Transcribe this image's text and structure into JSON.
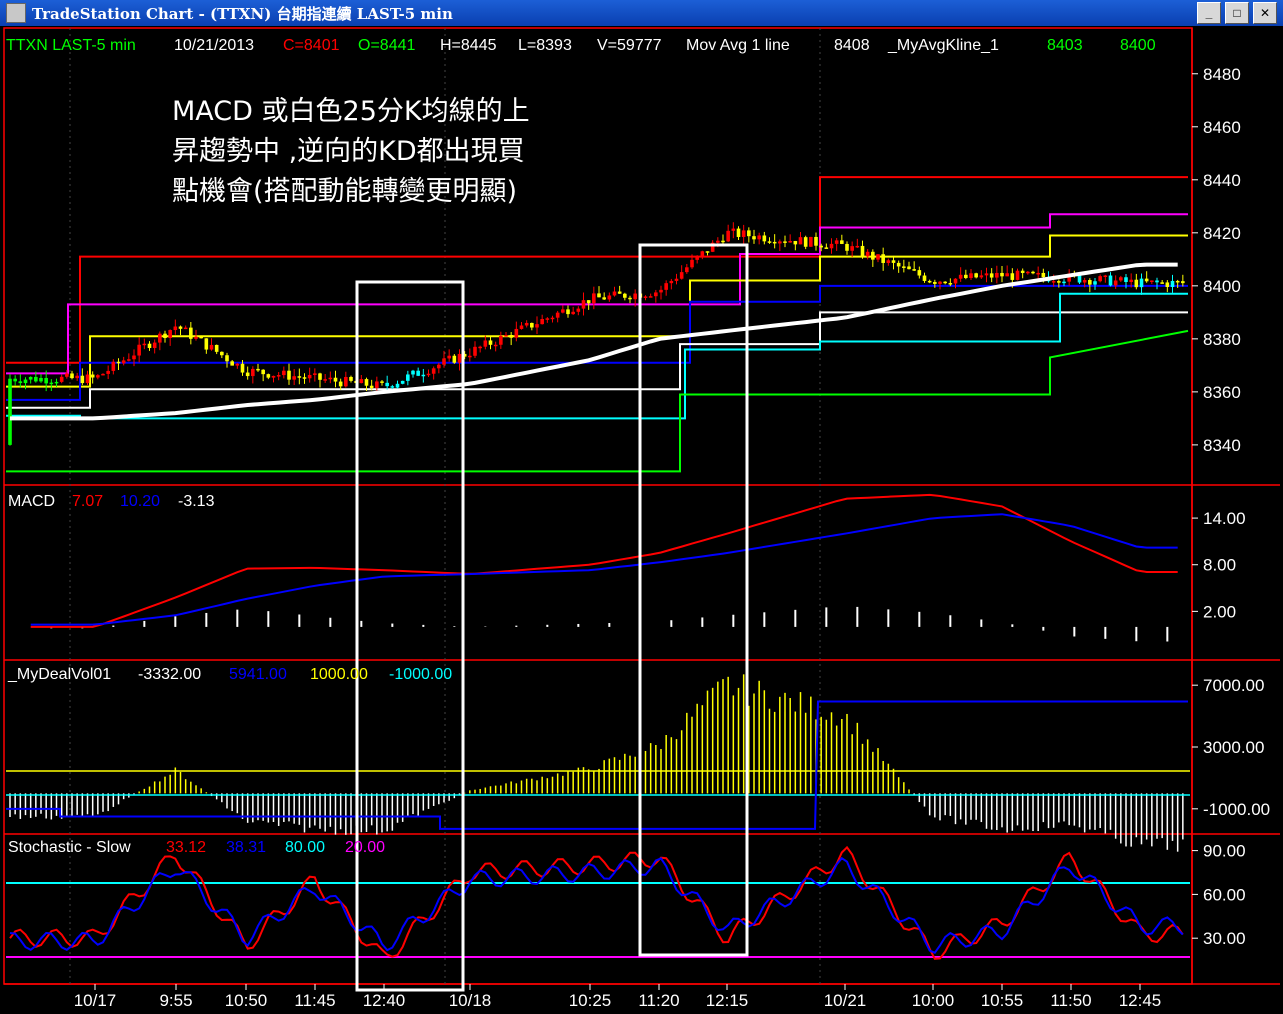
{
  "window": {
    "title": "TradeStation Chart - (TTXN) 台期指連續 LAST-5 min",
    "buttons": [
      "minimize",
      "maximize",
      "close"
    ]
  },
  "colors": {
    "background": "#000000",
    "up_candle": "#ff0000",
    "down_candle": "#ffff00",
    "cyan": "#00ffff",
    "green": "#00ff00",
    "blue": "#0000ff",
    "magenta": "#ff00ff",
    "white": "#ffffff"
  },
  "header": {
    "symbol": "TTXN LAST-5 min",
    "date": "10/21/2013",
    "close": "C=8401",
    "open": "O=8441",
    "high": "H=8445",
    "low": "L=8393",
    "volume": "V=59777",
    "study1": "Mov Avg 1 line",
    "study1_value": "8408",
    "study2": "_MyAvgKline_1",
    "study2_v1": "8403",
    "study2_v2": "8400"
  },
  "annotation": {
    "line1": "MACD 或白色25分K均線的上",
    "line2": "昇趨勢中 ,逆向的KD都出現買",
    "line3": "點機會(搭配動能轉變更明顯)"
  },
  "panels": {
    "macd": {
      "name": "MACD",
      "v1": "7.07",
      "v2": "10.20",
      "v3": "-3.13"
    },
    "dealvol": {
      "name": "_MyDealVol01",
      "v1": "-3332.00",
      "v2": "5941.00",
      "v3": "1000.00",
      "v4": "-1000.00"
    },
    "stoch": {
      "name": "Stochastic - Slow",
      "v1": "33.12",
      "v2": "38.31",
      "v3": "80.00",
      "v4": "20.00"
    }
  },
  "price_axis": [
    "8480",
    "8460",
    "8440",
    "8420",
    "8400",
    "8380",
    "8360",
    "8340"
  ],
  "macd_axis": [
    "14.00",
    "8.00",
    "2.00"
  ],
  "vol_axis": [
    "7000.00",
    "3000.00",
    "-1000.00"
  ],
  "stoch_axis": [
    "90.00",
    "60.00",
    "30.00"
  ],
  "time_axis": [
    "10/17",
    "9:55",
    "10:50",
    "11:45",
    "12:40",
    "10/18",
    "10:25",
    "11:20",
    "12:15",
    "10/21",
    "10:00",
    "10:55",
    "11:50",
    "12:45"
  ],
  "chart_data": [
    {
      "type": "candlestick",
      "title": "TTXN LAST-5 min",
      "ylim": [
        8326,
        8495
      ],
      "x": [
        "10/17",
        "9:55",
        "10:50",
        "11:45",
        "12:40",
        "10/18",
        "10:25",
        "11:20",
        "12:15",
        "10/21",
        "10:00",
        "10:55",
        "11:50",
        "12:45"
      ],
      "close": [
        8365,
        8385,
        8368,
        8365,
        8362,
        8375,
        8395,
        8398,
        8420,
        8415,
        8402,
        8404,
        8403,
        8401
      ],
      "series": [
        {
          "name": "Mov Avg 1 line",
          "values": [
            8350,
            8352,
            8355,
            8357,
            8360,
            8363,
            8372,
            8380,
            8383,
            8388,
            8395,
            8400,
            8404,
            8408
          ]
        },
        {
          "name": "_MyAvgKline_1",
          "values": [
            8411,
            8411,
            8411,
            8411,
            8411,
            8411,
            8411,
            8411,
            8441,
            8441,
            8441,
            8441,
            8441,
            8441
          ]
        }
      ]
    },
    {
      "type": "line",
      "title": "MACD",
      "ylim": [
        -4,
        18
      ],
      "x": [
        "10/17",
        "9:55",
        "10:50",
        "11:45",
        "12:40",
        "10/18",
        "10:25",
        "11:20",
        "12:15",
        "10/21",
        "10:00",
        "10:55",
        "11:50",
        "12:45"
      ],
      "series": [
        {
          "values": [
            0.0,
            3.8,
            7.5,
            7.6,
            7.3,
            6.8,
            8.0,
            9.5,
            12.0,
            16.5,
            17.0,
            15.5,
            11.0,
            7.07
          ]
        },
        {
          "values": [
            0.3,
            1.5,
            3.6,
            5.3,
            6.5,
            6.8,
            7.3,
            8.3,
            9.5,
            12.0,
            14.0,
            14.5,
            13.0,
            10.2
          ]
        }
      ]
    },
    {
      "type": "bar",
      "title": "_MyDealVol01",
      "ylim": [
        -2500,
        8500
      ],
      "x": [
        "10/17",
        "9:55",
        "10:50",
        "11:45",
        "12:40",
        "10/18",
        "10:25",
        "11:20",
        "12:15",
        "10/21",
        "10:00",
        "10:55",
        "11:50",
        "12:45"
      ],
      "values": [
        -1500,
        1500,
        -1800,
        -2300,
        -2400,
        200,
        1600,
        3100,
        7000,
        5000,
        -1500,
        -2300,
        -2000,
        -3332
      ]
    },
    {
      "type": "line",
      "title": "Stochastic - Slow",
      "ylim": [
        0,
        100
      ],
      "x": [
        "10/17",
        "9:55",
        "10:50",
        "11:45",
        "12:40",
        "10/18",
        "10:25",
        "11:20",
        "12:15",
        "10/21",
        "10:00",
        "10:55",
        "11:50",
        "12:45"
      ],
      "series": [
        {
          "values": [
            30,
            88,
            25,
            70,
            15,
            75,
            80,
            85,
            30,
            88,
            20,
            40,
            85,
            33.12
          ]
        },
        {
          "values": [
            28,
            80,
            30,
            65,
            25,
            70,
            75,
            80,
            35,
            80,
            25,
            35,
            80,
            38.31
          ]
        }
      ]
    }
  ]
}
